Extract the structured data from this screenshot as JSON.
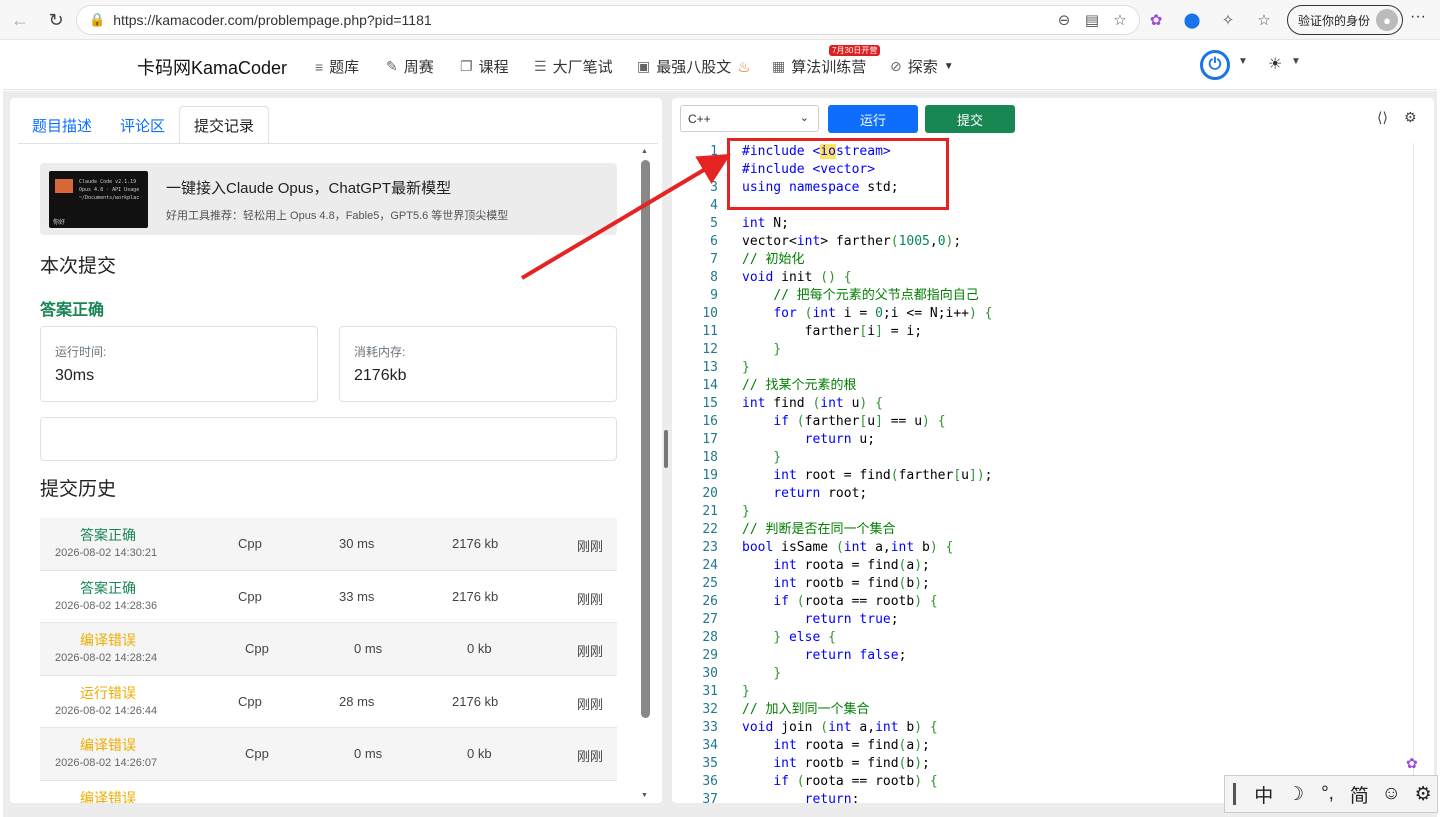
{
  "browser": {
    "url": "https://kamacoder.com/problempage.php?pid=1181",
    "profile_label": "验证你的身份"
  },
  "site": {
    "brand": "卡码网KamaCoder",
    "nav": [
      {
        "label": "题库",
        "icon": "list-icon"
      },
      {
        "label": "周赛",
        "icon": "pencil-icon"
      },
      {
        "label": "课程",
        "icon": "copy-icon"
      },
      {
        "label": "大厂笔试",
        "icon": "document-icon"
      },
      {
        "label": "最强八股文",
        "icon": "note-icon"
      },
      {
        "label": "算法训练营",
        "icon": "calendar-icon"
      },
      {
        "label": "探索",
        "icon": "compass-icon"
      }
    ],
    "badge": "7月30日开营"
  },
  "left_tabs": [
    "题目描述",
    "评论区",
    "提交记录"
  ],
  "ad": {
    "title": "一键接入Claude Opus，ChatGPT最新模型",
    "subtitle": "好用工具推荐：轻松用上 Opus 4.8，Fable5，GPT5.6 等世界顶尖模型",
    "thumb_lines": [
      "Claude Code v2.1.19",
      "Opus 4.8 · API Usage",
      "~/Documents/workplac"
    ],
    "thumb_footer": "你好"
  },
  "current_submission": {
    "heading": "本次提交",
    "result": "答案正确",
    "runtime_label": "运行时间:",
    "runtime_value": "30ms",
    "memory_label": "消耗内存:",
    "memory_value": "2176kb"
  },
  "history": {
    "heading": "提交历史",
    "rows": [
      {
        "status": "答案正确",
        "kind": "ok",
        "time": "2026-08-02 14:30:21",
        "lang": "Cpp",
        "runtime": "30 ms",
        "memory": "2176 kb",
        "when": "刚刚"
      },
      {
        "status": "答案正确",
        "kind": "ok",
        "time": "2026-08-02 14:28:36",
        "lang": "Cpp",
        "runtime": "33 ms",
        "memory": "2176 kb",
        "when": "刚刚"
      },
      {
        "status": "编译错误",
        "kind": "warn",
        "time": "2026-08-02 14:28:24",
        "lang": "Cpp",
        "runtime": "0 ms",
        "memory": "0 kb",
        "when": "刚刚"
      },
      {
        "status": "运行错误",
        "kind": "warn",
        "time": "2026-08-02 14:26:44",
        "lang": "Cpp",
        "runtime": "28 ms",
        "memory": "2176 kb",
        "when": "刚刚"
      },
      {
        "status": "编译错误",
        "kind": "warn",
        "time": "2026-08-02 14:26:07",
        "lang": "Cpp",
        "runtime": "0 ms",
        "memory": "0 kb",
        "when": "刚刚"
      },
      {
        "status": "编译错误",
        "kind": "warn",
        "time": "",
        "lang": "",
        "runtime": "",
        "memory": "",
        "when": ""
      }
    ]
  },
  "editor": {
    "language": "C++",
    "run_label": "运行",
    "submit_label": "提交",
    "lines": [
      "#include <iostream>",
      "#include <vector>",
      "using namespace std;",
      "",
      "int N;",
      "vector<int> farther(1005,0);",
      "// 初始化",
      "void init () {",
      "    // 把每个元素的父节点都指向自己",
      "    for (int i = 0;i <= N;i++) {",
      "        farther[i] = i;",
      "    }",
      "}",
      "// 找某个元素的根",
      "int find (int u) {",
      "    if (farther[u] == u) {",
      "        return u;",
      "    }",
      "    int root = find(farther[u]);",
      "    return root;",
      "}",
      "// 判断是否在同一个集合",
      "bool isSame (int a,int b) {",
      "    int roota = find(a);",
      "    int rootb = find(b);",
      "    if (roota == rootb) {",
      "        return true;",
      "    } else {",
      "        return false;",
      "    }",
      "}",
      "// 加入到同一个集合",
      "void join (int a,int b) {",
      "    int roota = find(a);",
      "    int rootb = find(b);",
      "    if (roota == rootb) {",
      "        return;"
    ]
  },
  "ime": {
    "items": [
      "中",
      "☽",
      "°,",
      "简",
      "☺",
      "⚙"
    ]
  }
}
